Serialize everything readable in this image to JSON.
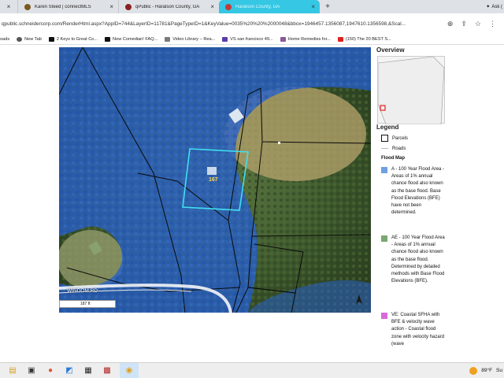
{
  "browser": {
    "tabs": [
      {
        "label": "Karen Steed | connectMLS",
        "color": "#7a5a20",
        "active": false
      },
      {
        "label": "qPublic - Haralson County, GA",
        "color": "#8a2222",
        "active": false
      },
      {
        "label": "Haralson County, GA",
        "color": "#c43a3a",
        "active": true
      }
    ],
    "new_tab": "+",
    "ask_label": "Ask (",
    "url": "qpublic.schneidercorp.com/RenderHtml.aspx?AppID=744&LayerID=11781&PageTypeID=1&KeyValue=0035%20%20%2000048&bbox=1946457.1356087,1947610.1356598,&Scal...",
    "bookmarks": [
      {
        "label": "oads",
        "color": "#00000000"
      },
      {
        "label": "New Tab",
        "color": "#555555"
      },
      {
        "label": "2 Keys to Great Co...",
        "color": "#111111"
      },
      {
        "label": "New Comedian! FAQ...",
        "color": "#111111"
      },
      {
        "label": "Video Library – Rea...",
        "color": "#7a7a7a"
      },
      {
        "label": "VS san francisco 49...",
        "color": "#5b3da8"
      },
      {
        "label": "Home Remedies for...",
        "color": "#8a5a9a"
      },
      {
        "label": "(150) The 20 BEST S...",
        "color": "#e02020"
      }
    ]
  },
  "map": {
    "parcel_label": "167",
    "road_label": "WINDOM RD",
    "scale_label": "187 ft",
    "flood_color": "#2860c8",
    "selected_parcel_color": "#3fe0f0"
  },
  "sidebar": {
    "overview_title": "Overview",
    "legend_title": "Legend",
    "legend_items": [
      {
        "label": "Parcels"
      },
      {
        "label": "Roads"
      }
    ],
    "flood_map_title": "Flood Map",
    "flood_zones": [
      {
        "color": "#6f9fe0",
        "text": "A - 100 Year Flood Area - Areas of 1% annual chance flood also known as the base flood. Base Flood Elevations (BFE) have not been determined."
      },
      {
        "color": "#7aa870",
        "text": "AE - 100 Year Flood Area - Areas of 1% annual chance flood also known as the base flood. Determined by detailed methods with Base Flood Elevations (BFE)."
      },
      {
        "color": "#d76adb",
        "text": "VE: Coastal SFHA with BFE & velocity wave action - Coastal flood zone with velocity hazard (wave"
      }
    ]
  },
  "taskbar": {
    "temperature": "89°F",
    "extra": "Su"
  }
}
